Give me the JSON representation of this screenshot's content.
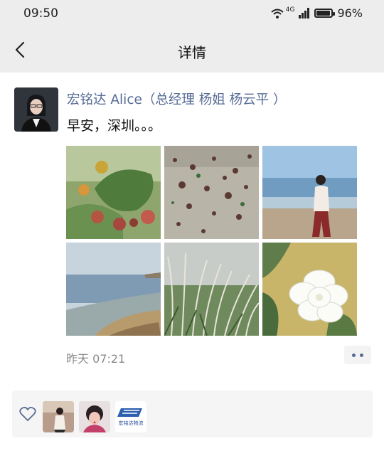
{
  "status_bar": {
    "time": "09:50",
    "network": "4G",
    "battery": "96%",
    "battery_level": 0.96
  },
  "nav": {
    "title": "详情"
  },
  "post": {
    "author": "宏铭达 Alice（总经理 杨姐 杨云平 ）",
    "text": "早安，深圳。。。",
    "images": [
      {
        "icon": "cactus-flower-photo"
      },
      {
        "icon": "sand-seaweed-photo"
      },
      {
        "icon": "woman-on-beach-photo"
      },
      {
        "icon": "seashore-photo"
      },
      {
        "icon": "reed-grass-photo"
      },
      {
        "icon": "white-gardenia-photo"
      }
    ],
    "time": "昨天 07:21"
  },
  "likes": {
    "icon": "heart-icon",
    "users": [
      {
        "icon": "woman-portrait-avatar"
      },
      {
        "icon": "girl-selfie-avatar"
      },
      {
        "icon": "logo-avatar",
        "logo_text": "宏铭达物流"
      }
    ]
  },
  "colors": {
    "link": "#576b95",
    "header_bg": "#ededed",
    "muted": "#8a8a8a"
  }
}
